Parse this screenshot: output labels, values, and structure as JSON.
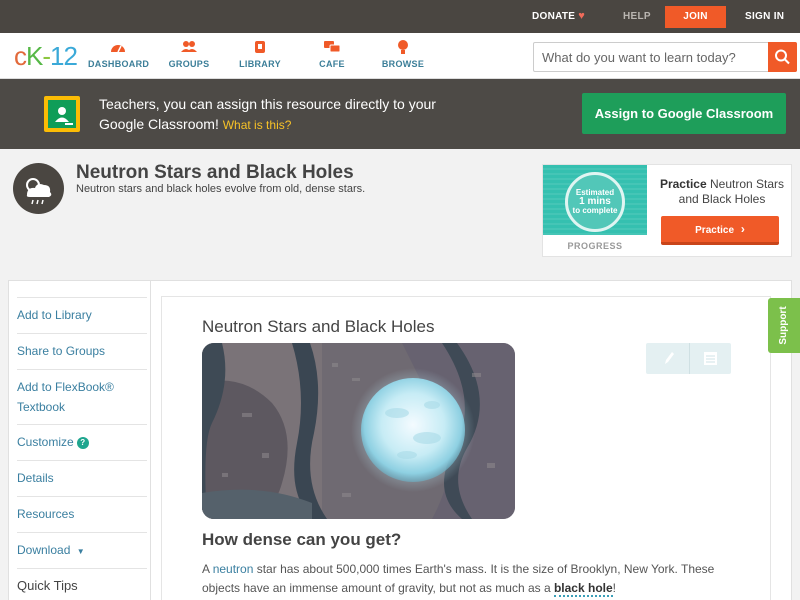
{
  "topbar": {
    "donate": "DONATE",
    "help": "HELP",
    "join": "JOIN",
    "signin": "SIGN IN"
  },
  "nav": {
    "logo": {
      "c": "c",
      "k": "K",
      "dash": "-",
      "num": "12"
    },
    "items": [
      {
        "label": "DASHBOARD",
        "icon": "gauge-icon"
      },
      {
        "label": "GROUPS",
        "icon": "people-icon"
      },
      {
        "label": "LIBRARY",
        "icon": "library-icon"
      },
      {
        "label": "CAFE",
        "icon": "chat-bubbles-icon"
      },
      {
        "label": "BROWSE",
        "icon": "lightbulb-icon"
      }
    ],
    "search_placeholder": "What do you want to learn today?"
  },
  "google_banner": {
    "text": "Teachers, you can assign this resource directly to your Google Classroom!",
    "what": "What is this?",
    "button": "Assign to Google Classroom"
  },
  "concept": {
    "title": "Neutron Stars and Black Holes",
    "subtitle": "Neutron stars and black holes evolve from old, dense stars."
  },
  "practice_card": {
    "estimated": "Estimated",
    "mins": "1 mins",
    "to_complete": "to complete",
    "progress": "PROGRESS",
    "title_bold": "Practice",
    "title_rest": "Neutron Stars and Black Holes",
    "button": "Practice"
  },
  "sidebar": {
    "items": [
      "Add to Library",
      "Share to Groups",
      "Add to FlexBook® Textbook",
      "Customize",
      "Details",
      "Resources",
      "Download",
      "Quick Tips"
    ]
  },
  "main": {
    "title": "Neutron Stars and Black Holes",
    "heading": "How dense can you get?",
    "para": {
      "a": "A ",
      "neutron": "neutron",
      "b": " star has about 500,000 times Earth's mass. It is the size of Brooklyn, New York. These objects have an immense amount of gravity, but not as much as a ",
      "black_hole": "black hole",
      "c": "!"
    }
  },
  "support": "Support",
  "colors": {
    "accent": "#f05a28",
    "google_green": "#1e9e5a",
    "link": "#3a7fa0"
  }
}
